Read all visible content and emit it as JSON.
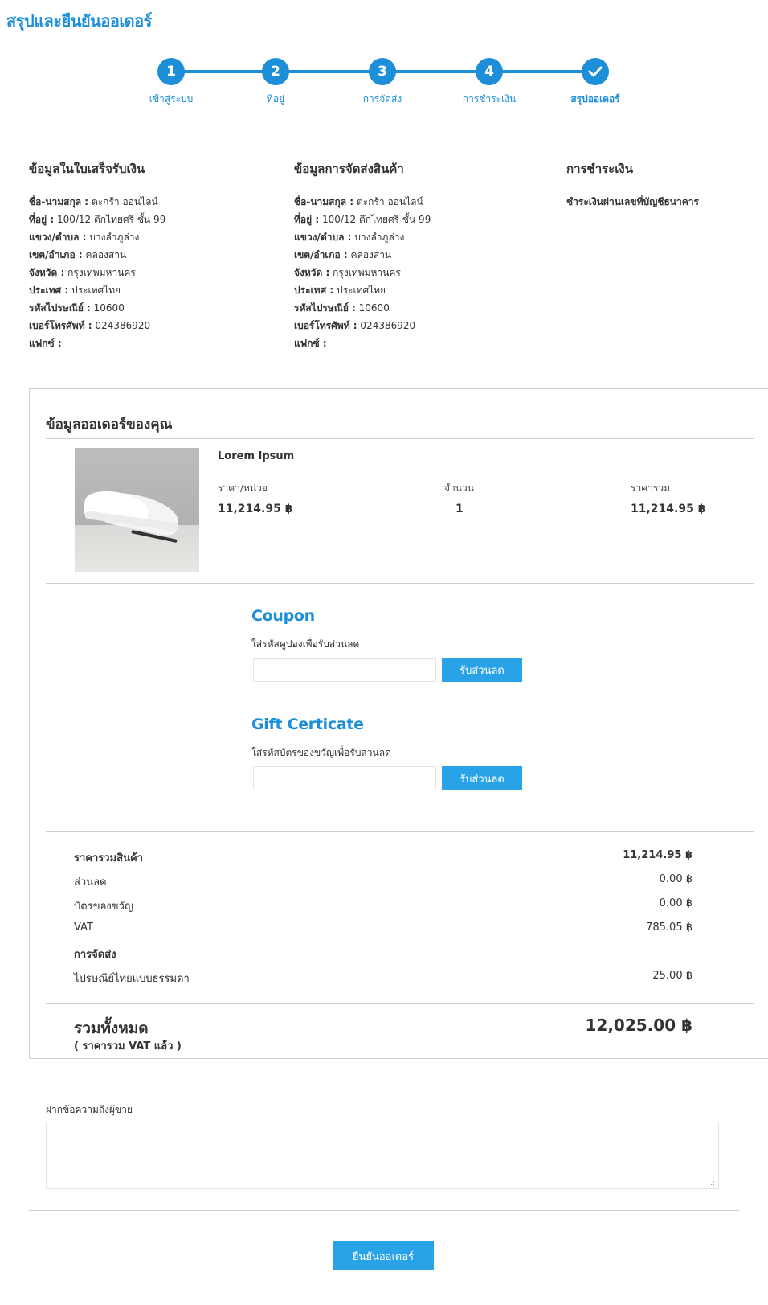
{
  "page": {
    "title": "สรุปและยืนยันออเดอร์"
  },
  "stepper": {
    "steps": [
      {
        "number": "1",
        "label": "เข้าสู่ระบบ"
      },
      {
        "number": "2",
        "label": "ที่อยู่"
      },
      {
        "number": "3",
        "label": "การจัดส่ง"
      },
      {
        "number": "4",
        "label": "การชำระเงิน"
      },
      {
        "number": "",
        "label": "สรุปออเดอร์",
        "icon": "check-icon"
      }
    ],
    "color": "#1d8ed8"
  },
  "billing": {
    "title": "ข้อมูลในใบเสร็จรับเงิน",
    "rows": [
      {
        "label": "ชื่อ-นามสกุล :",
        "value": "ตะกร้า ออนไลน์"
      },
      {
        "label": "ที่อยู่ :",
        "value": "100/12 ตึกไทยศรี ชั้น 99"
      },
      {
        "label": "แขวง/ตำบล :",
        "value": "บางลำภูล่าง"
      },
      {
        "label": "เขต/อำเภอ :",
        "value": "คลองสาน"
      },
      {
        "label": "จังหวัด :",
        "value": "กรุงเทพมหานคร"
      },
      {
        "label": "ประเทศ :",
        "value": "ประเทศไทย"
      },
      {
        "label": "รหัสไปรษณีย์ :",
        "value": "10600"
      },
      {
        "label": "เบอร์โทรศัพท์ :",
        "value": "024386920"
      },
      {
        "label": "แฟกซ์ :",
        "value": ""
      }
    ]
  },
  "shipping": {
    "title": "ข้อมูลการจัดส่งสินค้า",
    "rows": [
      {
        "label": "ชื่อ-นามสกุล :",
        "value": "ตะกร้า ออนไลน์"
      },
      {
        "label": "ที่อยู่ :",
        "value": "100/12 ตึกไทยศรี ชั้น 99"
      },
      {
        "label": "แขวง/ตำบล :",
        "value": "บางลำภูล่าง"
      },
      {
        "label": "เขต/อำเภอ :",
        "value": "คลองสาน"
      },
      {
        "label": "จังหวัด :",
        "value": "กรุงเทพมหานคร"
      },
      {
        "label": "ประเทศ :",
        "value": "ประเทศไทย"
      },
      {
        "label": "รหัสไปรษณีย์ :",
        "value": "10600"
      },
      {
        "label": "เบอร์โทรศัพท์ :",
        "value": "024386920"
      },
      {
        "label": "แฟกซ์ :",
        "value": ""
      }
    ]
  },
  "payment": {
    "title": "การชำระเงิน",
    "method": "ชำระเงินผ่านเลขที่บัญชีธนาคาร"
  },
  "order": {
    "title": "ข้อมูลออเดอร์ของคุณ",
    "product": {
      "name": "Lorem Ipsum",
      "unit_price_label": "ราคา/หน่วย",
      "unit_price": "11,214.95 ฿",
      "qty_label": "จำนวน",
      "qty": "1",
      "total_label": "ราคารวม",
      "total": "11,214.95 ฿"
    },
    "coupon": {
      "title": "Coupon",
      "hint": "ใส่รหัสคูปองเพื่อรับส่วนลด",
      "value": "",
      "button": "รับส่วนลด"
    },
    "gift": {
      "title": "Gift Certicate",
      "hint": "ใส่รหัสบัตรของขวัญเพื่อรับส่วนลด",
      "value": "",
      "button": "รับส่วนลด"
    },
    "summary": {
      "subtotal_label": "ราคารวมสินค้า",
      "subtotal": "11,214.95 ฿",
      "discount_label": "ส่วนลด",
      "discount": "0.00 ฿",
      "gift_label": "บัตรของขวัญ",
      "gift": "0.00 ฿",
      "vat_label": "VAT",
      "vat": "785.05 ฿",
      "shipping_label": "การจัดส่ง",
      "shipping_method": "ไปรษณีย์ไทยแบบธรรมดา",
      "shipping_cost": "25.00 ฿"
    },
    "total": {
      "label": "รวมทั้งหมด",
      "note": "( ราคารวม VAT แล้ว )",
      "value": "12,025.00 ฿"
    }
  },
  "message": {
    "label": "ฝากข้อความถึงผู้ขาย",
    "value": ""
  },
  "confirm_button": "ยืนยันออเดอร์"
}
